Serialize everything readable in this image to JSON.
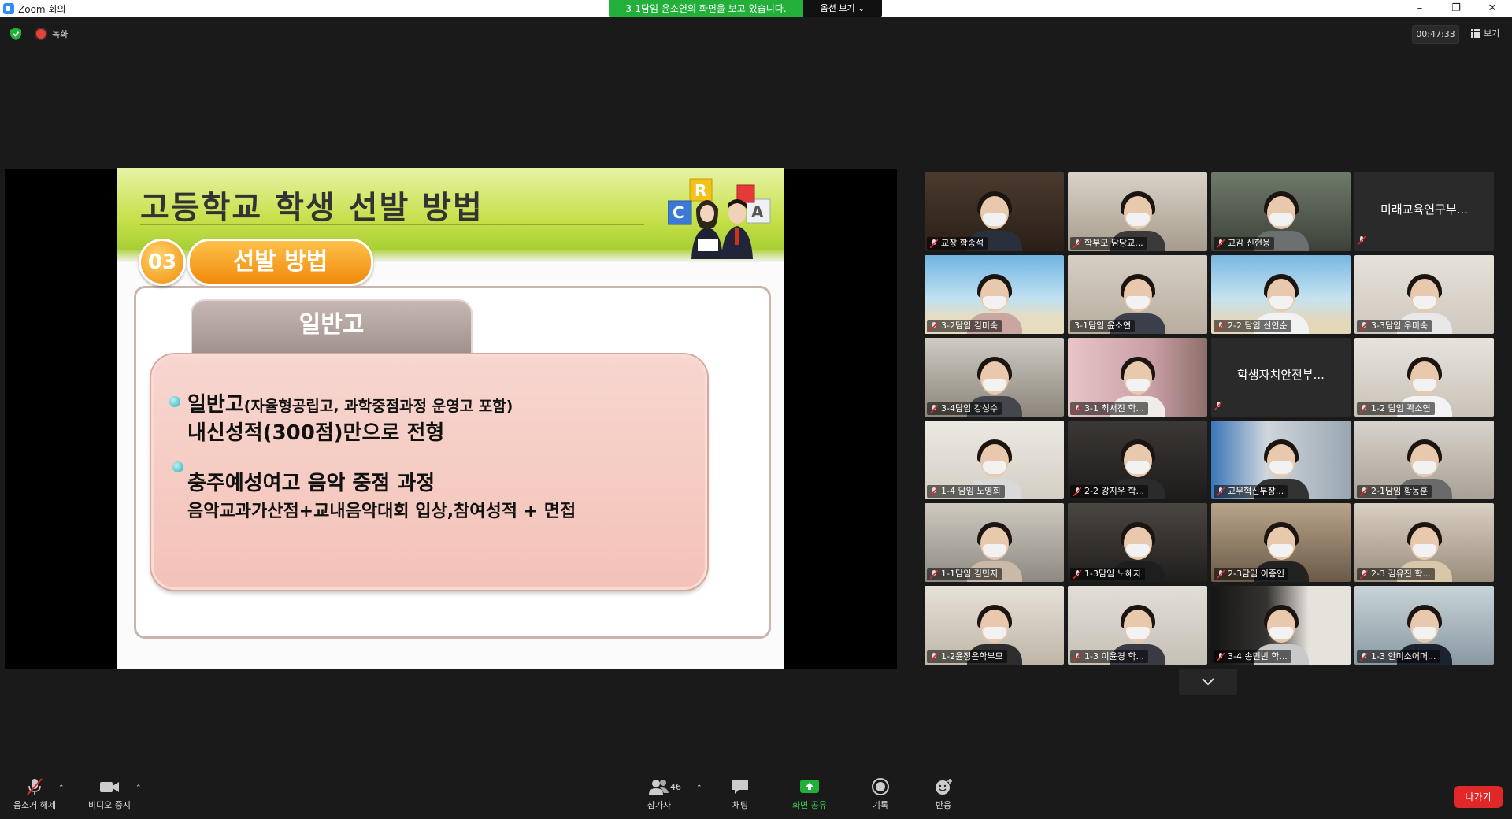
{
  "window": {
    "title": "Zoom 회의",
    "controls": [
      "–",
      "❐",
      "✕"
    ]
  },
  "share_banner": {
    "text": "3-1담임 윤소연의 화면을 보고 있습니다.",
    "options_label": "옵션 보기 ⌄"
  },
  "top_bar": {
    "recording_label": "녹화",
    "timer": "00:47:33",
    "view_label": "보기"
  },
  "slide": {
    "title": "고등학교 학생 선발 방법",
    "number": "03",
    "section": "선발 방법",
    "tab": "일반고",
    "bullet1_main": "일반고",
    "bullet1_paren": "(자율형공립고, 과학중점과정 운영고 포함)",
    "bullet1_line2": "내신성적(300점)만으로 전형",
    "bullet2_main": "충주예성여고 음악 중점 과정",
    "bullet2_line2": "음악교과가산점+교내음악대회 입상,참여성적 + 면접",
    "deco_letters": [
      "R",
      "C",
      "A"
    ]
  },
  "participants": [
    {
      "name": "교장 함종석",
      "muted": true
    },
    {
      "name": "학부모 담당교...",
      "muted": true
    },
    {
      "name": "교감 신현웅",
      "muted": true
    },
    {
      "name": "미래교육연구부...",
      "muted": true,
      "video_off": true
    },
    {
      "name": "3-2담임 김미숙",
      "muted": true
    },
    {
      "name": "3-1담임 윤소연",
      "muted": false,
      "active": true
    },
    {
      "name": "2-2 담임 신인순",
      "muted": true
    },
    {
      "name": "3-3담임 우미숙",
      "muted": true
    },
    {
      "name": "3-4담임 강성수",
      "muted": true
    },
    {
      "name": "3-1 최서진 학...",
      "muted": true
    },
    {
      "name": "학생자치안전부...",
      "muted": true,
      "video_off": true
    },
    {
      "name": "1-2 담임 곽소연",
      "muted": true
    },
    {
      "name": "1-4 담임 노영희",
      "muted": true
    },
    {
      "name": "2-2 강지우 학...",
      "muted": true
    },
    {
      "name": "교무혁신부장...",
      "muted": true
    },
    {
      "name": "2-1담임 황동훈",
      "muted": true
    },
    {
      "name": "1-1담임 김민지",
      "muted": true
    },
    {
      "name": "1-3담임 노혜지",
      "muted": true
    },
    {
      "name": "2-3담임 이종인",
      "muted": true
    },
    {
      "name": "2-3 김유진 학...",
      "muted": true
    },
    {
      "name": "1-2윤정은학부모",
      "muted": true
    },
    {
      "name": "1-3 이윤경 학...",
      "muted": true
    },
    {
      "name": "3-4 송민빈 학...",
      "muted": true
    },
    {
      "name": "1-3 안미소어머...",
      "muted": true
    }
  ],
  "toolbar": {
    "mute_label": "음소거 해제",
    "video_label": "비디오 중지",
    "participants_label": "참가자",
    "participants_count": "46",
    "chat_label": "채팅",
    "share_label": "화면 공유",
    "record_label": "기록",
    "reactions_label": "반응",
    "leave_label": "나가기"
  },
  "colors": {
    "share_green": "#23b03a",
    "leave_red": "#e02828",
    "active_speaker": "#e6e651"
  }
}
